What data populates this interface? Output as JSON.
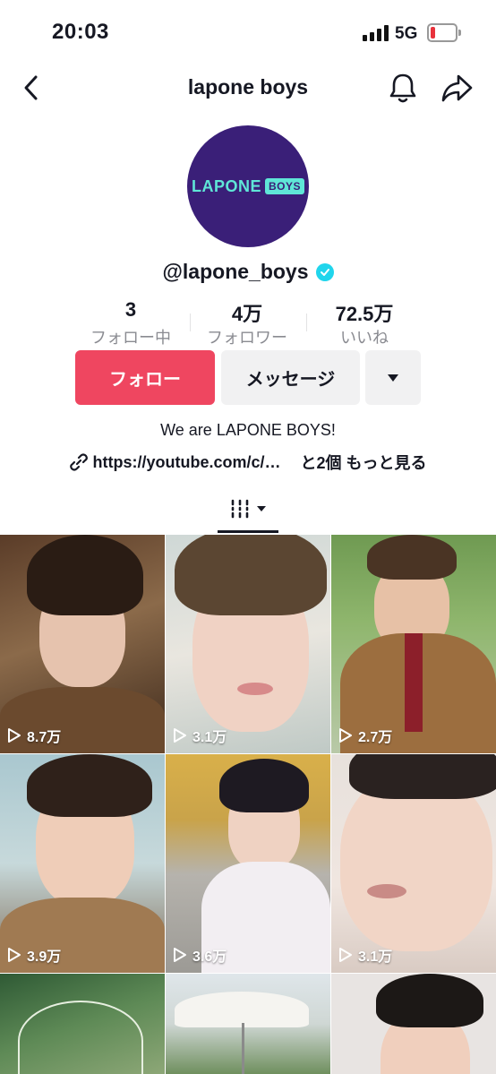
{
  "status_bar": {
    "time": "20:03",
    "network": "5G"
  },
  "header": {
    "title": "lapone boys"
  },
  "profile": {
    "avatar_logo_word": "LAPONE",
    "avatar_logo_badge": "BOYS",
    "username": "@lapone_boys",
    "bio": "We are LAPONE BOYS!",
    "link": "https://youtube.com/c/…",
    "more_links": "と2個 もっと見る"
  },
  "stats": [
    {
      "value": "3",
      "label": "フォロー中"
    },
    {
      "value": "4万",
      "label": "フォロワー"
    },
    {
      "value": "72.5万",
      "label": "いいね"
    }
  ],
  "buttons": {
    "follow": "フォロー",
    "message": "メッセージ"
  },
  "videos": [
    {
      "plays": "8.7万"
    },
    {
      "plays": "3.1万"
    },
    {
      "plays": "2.7万"
    },
    {
      "plays": "3.9万"
    },
    {
      "plays": "3.6万"
    },
    {
      "plays": "3.1万"
    }
  ],
  "colors": {
    "follow": "#ef4660",
    "verified": "#20d5ec",
    "avatar_bg": "#3a1f78",
    "logo": "#5fe6d7"
  }
}
